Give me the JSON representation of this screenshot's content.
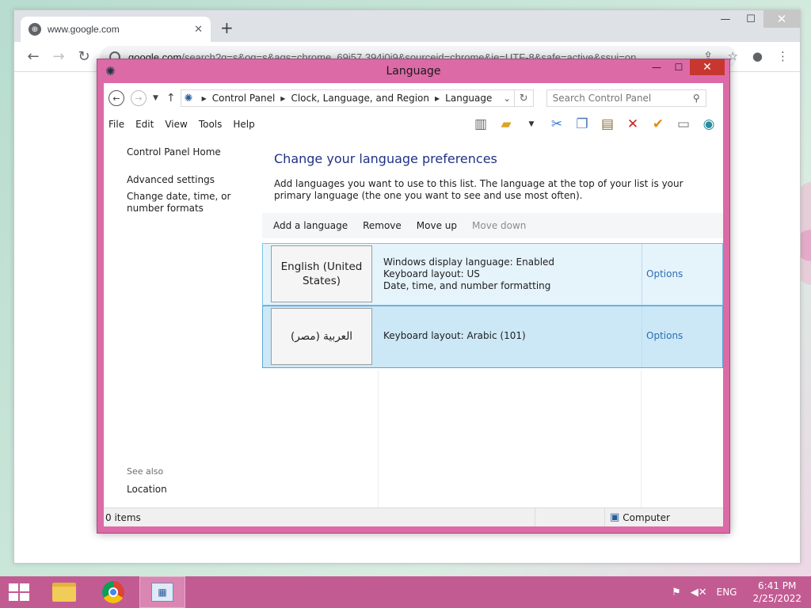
{
  "browser": {
    "tab_title": "www.google.com",
    "tab_close": "✕",
    "new_tab": "+",
    "address_host": "google.com",
    "address_path": "/search?q=s&oq=s&aqs=chrome..69i57.394j0j9&sourceid=chrome&ie=UTF-8&safe=active&ssui=on",
    "back": "←",
    "forward": "→",
    "reload": "↻",
    "minimize": "—",
    "maximize": "☐",
    "close": "✕"
  },
  "window": {
    "title": "Language",
    "minimize": "—",
    "maximize": "☐",
    "close": "✕",
    "breadcrumb": [
      "Control Panel",
      "Clock, Language, and Region",
      "Language"
    ],
    "search_placeholder": "Search Control Panel"
  },
  "menu": [
    "File",
    "Edit",
    "View",
    "Tools",
    "Help"
  ],
  "toolbar_icons": [
    "layout-icon",
    "folder-icon",
    "dropdown-icon",
    "cut-icon",
    "copy-icon",
    "paste-icon",
    "delete-icon",
    "checkmark-icon",
    "properties-icon",
    "globe-icon"
  ],
  "sidebar": {
    "links": [
      "Control Panel Home",
      "Advanced settings",
      "Change date, time, or number formats"
    ],
    "see_also_heading": "See also",
    "see_also_link": "Location"
  },
  "main": {
    "title": "Change your language preferences",
    "intro": "Add languages you want to use to this list. The language at the top of your list is your primary language (the one you want to see and use most often).",
    "commands": [
      "Add a language",
      "Remove",
      "Move up",
      "Move down"
    ],
    "languages": [
      {
        "name": "English (United States)",
        "details": [
          "Windows display language: Enabled",
          "Keyboard layout: US",
          "Date, time, and number formatting"
        ],
        "options": "Options"
      },
      {
        "name": "العربية (مصر)",
        "details": [
          "Keyboard layout: Arabic (101)"
        ],
        "options": "Options"
      }
    ]
  },
  "status": {
    "items": "0 items",
    "location": "Computer"
  },
  "taskbar": {
    "language": "ENG",
    "time": "6:41 PM",
    "date": "2/25/2022"
  },
  "colors": {
    "window_frame": "#dc6aa6",
    "taskbar": "#c35b93",
    "close_button": "#c7372f",
    "link": "#2c6db4",
    "heading": "#1e3287",
    "selected_row": "#cce8f7"
  }
}
